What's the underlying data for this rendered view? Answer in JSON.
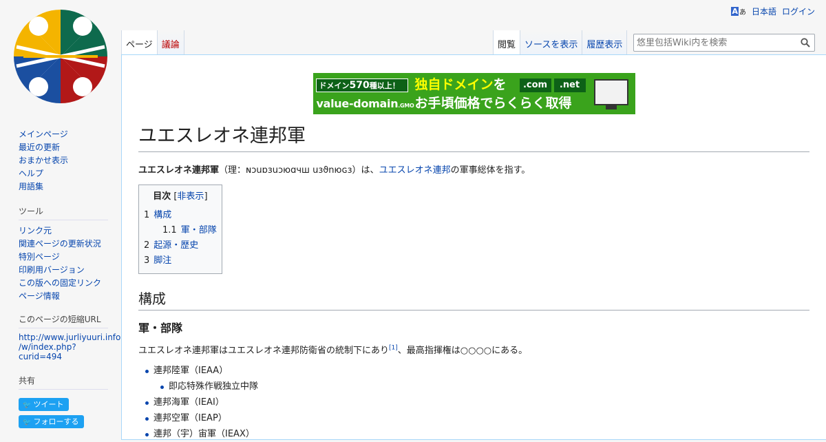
{
  "personal": {
    "uls_a": "A",
    "uls_b": "あ",
    "language": "日本語",
    "login": "ログイン"
  },
  "tabs_left": [
    {
      "label": "ページ"
    },
    {
      "label": "議論"
    }
  ],
  "tabs_right": [
    {
      "label": "閲覧"
    },
    {
      "label": "ソースを表示"
    },
    {
      "label": "履歴表示"
    }
  ],
  "search": {
    "placeholder": "悠里包括Wiki内を検索"
  },
  "banner": {
    "tag_prefix": "ドメイン",
    "tag_num": "570",
    "tag_suffix": "種以上！",
    "brand": "value-domain",
    "gmo": ".GMO",
    "line1_a": "独自ドメイン",
    "line1_b": "を",
    "com": ".com",
    "net": ".net",
    "line2": "お手頃価格でらくらく取得"
  },
  "page": {
    "title": "ユエスレオネ連邦軍",
    "lead_bold": "ユエスレオネ連邦軍",
    "lead_paren": "（理：ɴɔuɒɜuɔюɑчш uɜϑnюɢɜ）は、",
    "lead_link": "ユエスレオネ連邦",
    "lead_rest": "の軍事総体を指す。"
  },
  "toc": {
    "title": "目次",
    "toggle_open": "[",
    "toggle": "非表示",
    "toggle_close": "]",
    "entries": [
      {
        "num": "1",
        "text": "構成"
      },
      {
        "num": "1.1",
        "text": "軍・部隊"
      },
      {
        "num": "2",
        "text": "起源・歴史"
      },
      {
        "num": "3",
        "text": "脚注"
      }
    ]
  },
  "section1": {
    "heading": "構成",
    "sub_heading": "軍・部隊",
    "para_a": "ユエスレオネ連邦軍はユエスレオネ連邦防衛省の統制下にあり",
    "ref": "[1]",
    "para_b": "、最高指揮権は○○○○にある。",
    "items": [
      "連邦陸軍（IEAA）",
      "即応特殊作戦独立中隊",
      "連邦海軍（IEAI）",
      "連邦空軍（IEAP）",
      "連邦（宇）宙軍（IEAX）"
    ]
  },
  "sidebar": {
    "nav": [
      "メインページ",
      "最近の更新",
      "おまかせ表示",
      "ヘルプ",
      "用語集"
    ],
    "tools_heading": "ツール",
    "tools": [
      "リンク元",
      "関連ページの更新状況",
      "特別ページ",
      "印刷用バージョン",
      "この版への固定リンク",
      "ページ情報"
    ],
    "shorturl_heading": "このページの短縮URL",
    "shorturl_1": "http://www.jurliyuuri.info",
    "shorturl_2": "/w/index.php?",
    "shorturl_3": "curid=494",
    "share_heading": "共有",
    "tweet": "ツイート",
    "follow": "フォローする"
  },
  "colors": {
    "link": "#0645ad",
    "new_link": "#ba0000",
    "banner_green": "#3aa31c",
    "twitter": "#1da1f2"
  }
}
